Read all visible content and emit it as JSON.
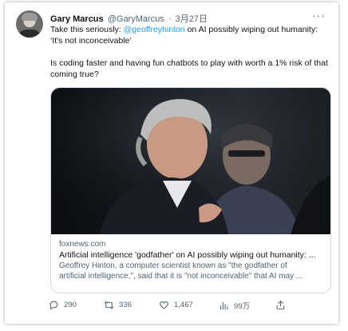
{
  "tweet": {
    "author_name": "Gary Marcus",
    "author_handle": "@GaryMarcus",
    "separator": "·",
    "date": "3月27日",
    "text_part1": "Take this seriously:  ",
    "mention": "@geoffreyhinton",
    "text_part2": " on AI possibly wiping out humanity: ‘It's not inconceivable’",
    "text_para2": "Is coding faster and having fun chatbots to play with worth a 1% risk of that coming true?"
  },
  "card": {
    "domain": "foxnews.com",
    "title": "Artificial intelligence 'godfather' on AI possibly wiping out humanity: ...",
    "desc_line1": "Geoffrey Hinton, a computer scientist known as \"the godfather of",
    "desc_line2": "artificial intelligence,\", said that it is \"not inconceivable\" that AI may ..."
  },
  "actions": {
    "replies": "290",
    "retweets": "336",
    "likes": "1,467",
    "views": "99万"
  },
  "icons": [
    "more-icon",
    "reply-icon",
    "retweet-icon",
    "like-icon",
    "views-icon",
    "share-icon"
  ],
  "colors": {
    "link": "#1d9bf0",
    "text": "#0f1419",
    "muted": "#536471",
    "border": "#cfd9de"
  }
}
